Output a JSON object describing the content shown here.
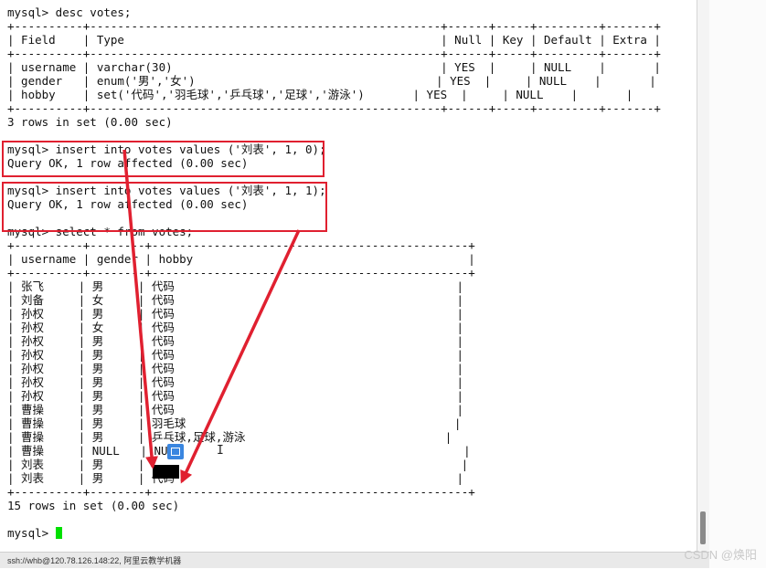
{
  "terminal": {
    "lines": [
      "mysql> desc votes;",
      "+----------+---------------------------------------------------+------+-----+---------+-------+",
      "| Field    | Type                                              | Null | Key | Default | Extra |",
      "+----------+---------------------------------------------------+------+-----+---------+-------+",
      "| username | varchar(30)                                       | YES  |     | NULL    |       |",
      "| gender   | enum('男','女')                                   | YES  |     | NULL    |       |",
      "| hobby    | set('代码','羽毛球','乒乓球','足球','游泳')       | YES  |     | NULL    |       |",
      "+----------+---------------------------------------------------+------+-----+---------+-------+",
      "3 rows in set (0.00 sec)",
      "",
      "mysql> insert into votes values ('刘表', 1, 0);",
      "Query OK, 1 row affected (0.00 sec)",
      "",
      "mysql> insert into votes values ('刘表', 1, 1);",
      "Query OK, 1 row affected (0.00 sec)",
      "",
      "mysql> select * from votes;",
      "+----------+--------+----------------------------------------------+",
      "| username | gender | hobby                                        |",
      "+----------+--------+----------------------------------------------+",
      "| 张飞     | 男     | 代码                                         |",
      "| 刘备     | 女     | 代码                                         |",
      "| 孙权     | 男     | 代码                                         |",
      "| 孙权     | 女     | 代码                                         |",
      "| 孙权     | 男     | 代码                                         |",
      "| 孙权     | 男     | 代码                                         |",
      "| 孙权     | 男     | 代码                                         |",
      "| 孙权     | 男     | 代码                                         |",
      "| 孙权     | 男     | 代码                                         |",
      "| 曹操     | 男     | 代码                                         |",
      "| 曹操     | 男     | 羽毛球                                       |",
      "| 曹操     | 男     | 乒乓球,足球,游泳                             |",
      "| 曹操     | NULL   | NULL                                         |",
      "| 刘表     | 男     |                                              |",
      "| 刘表     | 男     | 代码                                         |",
      "+----------+--------+----------------------------------------------+",
      "15 rows in set (0.00 sec)",
      "",
      "mysql> "
    ]
  },
  "statusbar": {
    "text": "ssh://whb@120.78.126.148:22, 阿里云教学机器"
  },
  "watermark": {
    "text": "CSDN @焕阳"
  },
  "colors": {
    "annotation": "#e02030",
    "cursor": "#00e000",
    "ime": "#3a86e0"
  },
  "icons": [
    "text-cursor-icon",
    "ime-toolbar-icon"
  ]
}
